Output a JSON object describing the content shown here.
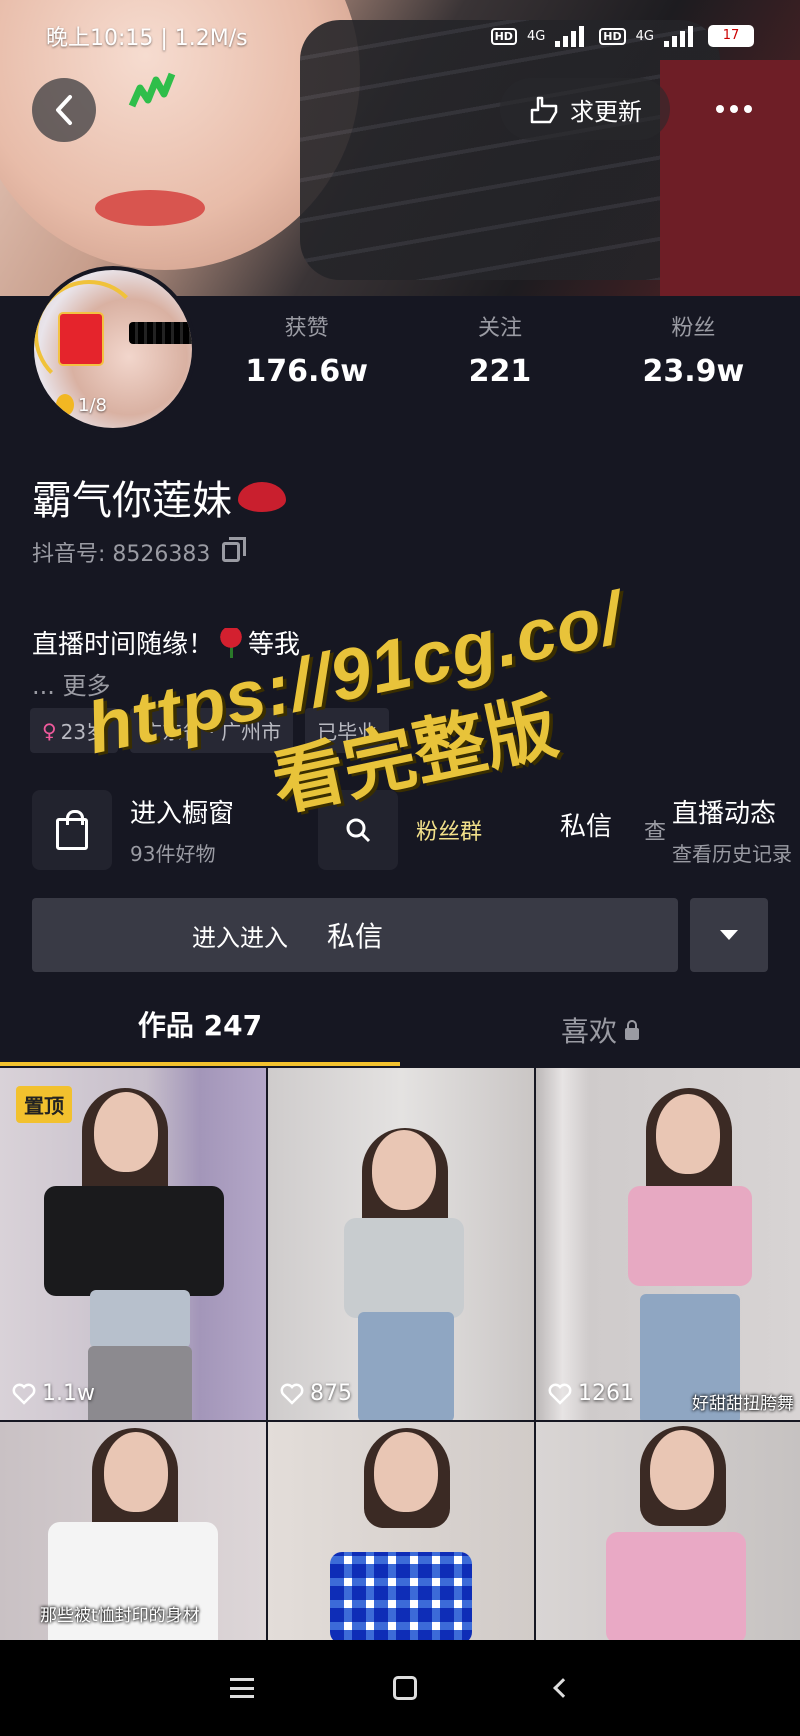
{
  "status_bar": {
    "time": "晚上10:15 | 1.2M/s",
    "network_1": "4G",
    "network_2": "4G",
    "battery": "17"
  },
  "header": {
    "update_label": "求更新"
  },
  "profile": {
    "avatar_counter": "1/8",
    "stats": [
      {
        "label": "获赞",
        "value": "176.6w"
      },
      {
        "label": "关注",
        "value": "221"
      },
      {
        "label": "粉丝",
        "value": "23.9w"
      }
    ],
    "nickname": "霸气你莲妹",
    "douyin_id": "抖音号: 8526383",
    "bio": "直播时间随缘！",
    "bio_suffix": "等我",
    "more": "... 更多",
    "tags": [
      "23岁",
      "广东省 · 广州市",
      "已毕业"
    ]
  },
  "services": {
    "shop_title": "进入橱窗",
    "shop_sub": "93件好物",
    "fans_title": "粉丝群",
    "message_label": "私信",
    "live_title": "直播动态",
    "live_sub": "查看历史记录",
    "live_prefix": "查"
  },
  "actions": {
    "enter_label": "进入进入",
    "message_label": "私信"
  },
  "tabs": {
    "works": "作品 247",
    "likes": "喜欢"
  },
  "watermark": {
    "url": "https://91cg.co/",
    "sub": "看完整版"
  },
  "videos": [
    {
      "likes": "1.1w",
      "pinned": "置顶"
    },
    {
      "likes": "875"
    },
    {
      "likes": "1261",
      "caption": "好甜甜扭胯舞"
    },
    {
      "caption": "那些被t恤封印的身材"
    },
    {},
    {}
  ],
  "colors": {
    "background": "#161722",
    "accent": "#f2c12e",
    "muted_text": "#9a9ba3",
    "button_bg": "#393a45"
  }
}
